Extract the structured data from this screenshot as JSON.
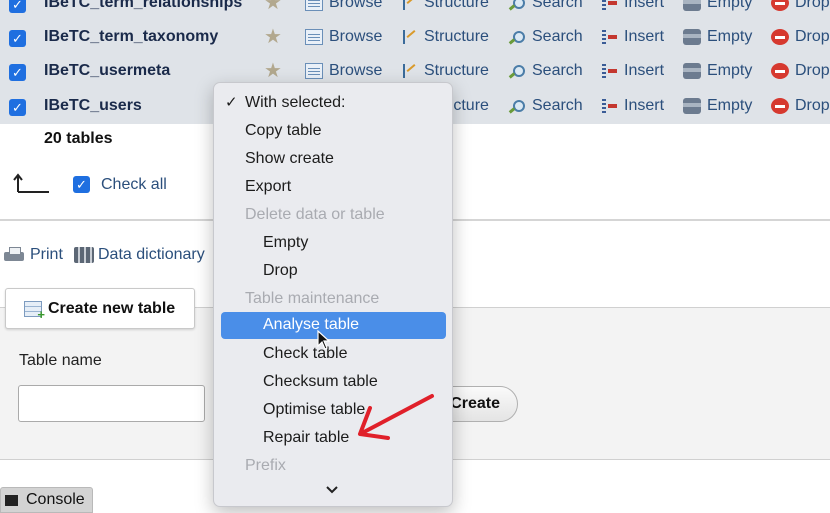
{
  "tables": [
    {
      "name": "IBeTC_term_relationships",
      "checked": true
    },
    {
      "name": "IBeTC_term_taxonomy",
      "checked": true
    },
    {
      "name": "IBeTC_usermeta",
      "checked": true
    },
    {
      "name": "IBeTC_users",
      "checked": true
    }
  ],
  "actions": {
    "browse": "Browse",
    "structure": "Structure",
    "search": "Search",
    "insert": "Insert",
    "empty": "Empty",
    "drop": "Drop"
  },
  "summary": {
    "count_label": "20 tables"
  },
  "bulk": {
    "check_all": "Check all"
  },
  "tools": {
    "print": "Print",
    "data_dictionary": "Data dictionary"
  },
  "create_panel": {
    "tab_label": "Create new table",
    "table_name_label": "Table name",
    "table_name_value": "",
    "create_button": "Create"
  },
  "console": {
    "label": "Console"
  },
  "menu": {
    "header": "With selected:",
    "header_check": "✓",
    "items": [
      {
        "label": "Copy table",
        "type": "item"
      },
      {
        "label": "Show create",
        "type": "item"
      },
      {
        "label": "Export",
        "type": "item"
      },
      {
        "label": "Delete data or table",
        "type": "group"
      },
      {
        "label": "Empty",
        "type": "subitem"
      },
      {
        "label": "Drop",
        "type": "subitem"
      },
      {
        "label": "Table maintenance",
        "type": "group"
      },
      {
        "label": "Analyse table",
        "type": "subitem",
        "selected": true
      },
      {
        "label": "Check table",
        "type": "subitem"
      },
      {
        "label": "Checksum table",
        "type": "subitem"
      },
      {
        "label": "Optimise table",
        "type": "subitem"
      },
      {
        "label": "Repair table",
        "type": "subitem"
      },
      {
        "label": "Prefix",
        "type": "group"
      }
    ]
  },
  "colors": {
    "row_bg": "#dfe3e8",
    "link": "#2b4f7c",
    "checkbox": "#1f6fe0",
    "menu_highlight": "#4a8ee8",
    "annotation_arrow": "#e0202a"
  },
  "icons": [
    "star-icon",
    "browse-icon",
    "structure-icon",
    "search-icon",
    "insert-icon",
    "empty-icon",
    "drop-icon",
    "print-icon",
    "data-dictionary-icon",
    "new-table-icon",
    "console-icon",
    "chevron-down-icon",
    "mouse-cursor-icon",
    "red-arrow-annotation"
  ]
}
